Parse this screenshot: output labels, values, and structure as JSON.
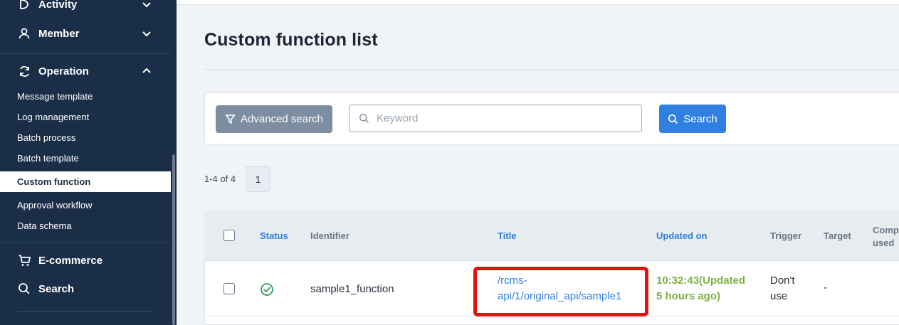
{
  "sidebar": {
    "items": [
      {
        "label": "Activity",
        "icon": "activity-icon"
      },
      {
        "label": "Member",
        "icon": "user-icon"
      },
      {
        "label": "Operation",
        "icon": "refresh-icon"
      },
      {
        "label": "E-commerce",
        "icon": "cart-icon"
      },
      {
        "label": "Search",
        "icon": "search-icon"
      }
    ],
    "operation_sub": [
      {
        "label": "Message template"
      },
      {
        "label": "Log management"
      },
      {
        "label": "Batch process"
      },
      {
        "label": "Batch template"
      },
      {
        "label": "Custom function",
        "active": true
      },
      {
        "label": "Approval workflow"
      },
      {
        "label": "Data schema"
      }
    ]
  },
  "page": {
    "title": "Custom function list"
  },
  "search": {
    "advanced_label": "Advanced search",
    "placeholder": "Keyword",
    "value": "",
    "button_label": "Search"
  },
  "pagination": {
    "count_text": "1-4 of 4",
    "current_page": "1"
  },
  "table": {
    "headers": {
      "status": "Status",
      "identifier": "Identifier",
      "title": "Title",
      "updated_on": "Updated on",
      "trigger": "Trigger",
      "target": "Target",
      "comp_line1": "Comp",
      "comp_line2": "used"
    },
    "rows": [
      {
        "status": "active",
        "identifier": "sample1_function",
        "title_line1": "/rcms-",
        "title_line2": "api/1/original_api/sample1",
        "updated_line1": "10:32:43(Updated",
        "updated_line2": "5 hours ago)",
        "trigger_line1": "Don't",
        "trigger_line2": "use",
        "target": "-"
      }
    ]
  },
  "colors": {
    "sidebar_bg": "#1b2e48",
    "accent": "#2f80e0",
    "updated_green": "#7cb342",
    "highlight_red": "#e0140f",
    "status_green": "#2e9e5b"
  }
}
